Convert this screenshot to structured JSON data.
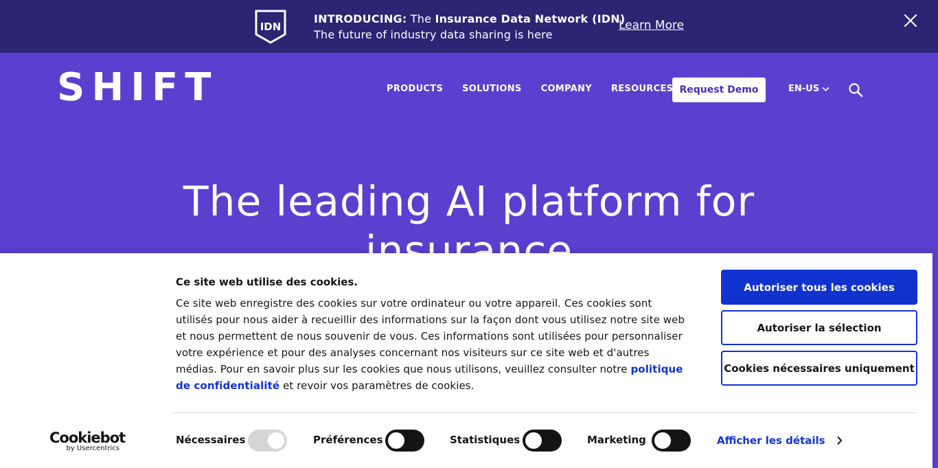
{
  "announcement": {
    "badge": "IDN",
    "intro_label": "INTRODUCING:",
    "intro_the": "The",
    "intro_name": "Insurance Data Network (IDN)",
    "subtitle": "The future of industry data sharing is here",
    "learn_more": "Learn More"
  },
  "header": {
    "logo": "SHIFT",
    "nav": [
      "PRODUCTS",
      "SOLUTIONS",
      "COMPANY",
      "RESOURCES"
    ],
    "demo_button": "Request Demo",
    "language": "EN-US"
  },
  "hero": {
    "title_line1": "The leading AI platform for",
    "title_line2": "insurance"
  },
  "cookie_banner": {
    "title": "Ce site web utilise des cookies.",
    "body_text": "Ce site web enregistre des cookies sur votre ordinateur ou votre appareil. Ces cookies sont utilisés pour nous aider à recueillir des informations sur la façon dont vous utilisez notre site web et nous permettent de nous souvenir de vous. Ces informations sont utilisées pour personnaliser votre expérience et pour des analyses concernant nos visiteurs sur ce site web et d'autres médias. Pour en savoir plus sur les cookies que nous utilisons, veuillez consulter notre",
    "link_text": "politique de confidentialité",
    "body_end": "et revoir vos paramètres de cookies.",
    "buttons": {
      "allow_all": "Autoriser tous les cookies",
      "allow_selection": "Autoriser la sélection",
      "necessary_only": "Cookies nécessaires uniquement"
    },
    "brand": {
      "name": "Cookiebot",
      "sub": "by Usercentrics"
    },
    "toggles": [
      {
        "label": "Nécessaires",
        "state": "disabled-on"
      },
      {
        "label": "Préférences",
        "state": "off"
      },
      {
        "label": "Statistiques",
        "state": "off"
      },
      {
        "label": "Marketing",
        "state": "off"
      }
    ],
    "details_link": "Afficher les détails"
  },
  "colors": {
    "announce_bg": "#2b2574",
    "hero_bg": "#5b3fcf",
    "primary_blue": "#1032cf"
  }
}
